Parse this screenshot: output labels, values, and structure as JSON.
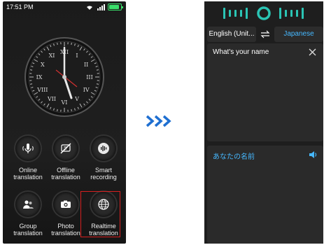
{
  "left_phone": {
    "status_time": "17:51 PM",
    "grid": [
      {
        "name": "online-translation",
        "label": "Online translation",
        "icon": "microphone-icon"
      },
      {
        "name": "offline-translation",
        "label": "Offline translation",
        "icon": "offline-icon"
      },
      {
        "name": "smart-recording",
        "label": "Smart recording",
        "icon": "waveform-icon"
      },
      {
        "name": "group-translation",
        "label": "Group translation",
        "icon": "group-icon"
      },
      {
        "name": "photo-translation",
        "label": "Photo translation",
        "icon": "camera-icon"
      },
      {
        "name": "realtime-translation",
        "label": "Realtime translation",
        "icon": "globe-icon",
        "selected": true
      }
    ]
  },
  "right_phone": {
    "source_language": "English (Unit...",
    "target_language": "Japanese",
    "source_text": "What's your name",
    "target_text": "あなたの名前"
  },
  "colors": {
    "accent_blue": "#46b8ff",
    "teal": "#2bc4b4",
    "highlight_red": "#d52020",
    "battery_green": "#3be06b"
  }
}
